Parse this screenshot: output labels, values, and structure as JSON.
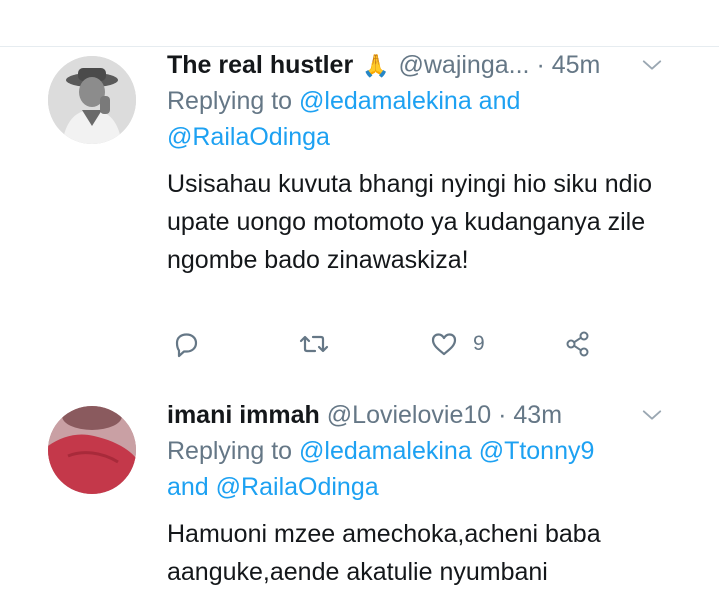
{
  "tweets": [
    {
      "name": "The real hustler",
      "emoji": "🙏",
      "handle": "@wajinga...",
      "dot": "·",
      "time": "45m",
      "replying_prefix": "Replying to",
      "mentions_line1": "@ledamalekina and",
      "mentions_line2": "@RailaOdinga",
      "text": "Usisahau kuvuta bhangi nyingi hio siku ndio upate uongo motomoto ya kudanganya zile ngombe bado zinawaskiza!",
      "actions": {
        "reply_icon": "reply-icon",
        "retweet_icon": "retweet-icon",
        "like_icon": "heart-icon",
        "like_count": "9",
        "share_icon": "share-icon"
      }
    },
    {
      "name": "imani immah",
      "handle": "@Lovielovie10",
      "dot": "·",
      "time": "43m",
      "replying_prefix": "Replying to",
      "mentions_line1_a": "@ledamalekina",
      "mentions_line1_b": "@Ttonny9",
      "mentions_line2_and": "and",
      "mentions_line2": "@RailaOdinga",
      "text": "Hamuoni mzee amechoka,acheni baba aanguke,aende akatulie nyumbani"
    }
  ],
  "colors": {
    "link": "#1da1f2",
    "secondary": "#657786",
    "primary": "#14171a"
  }
}
